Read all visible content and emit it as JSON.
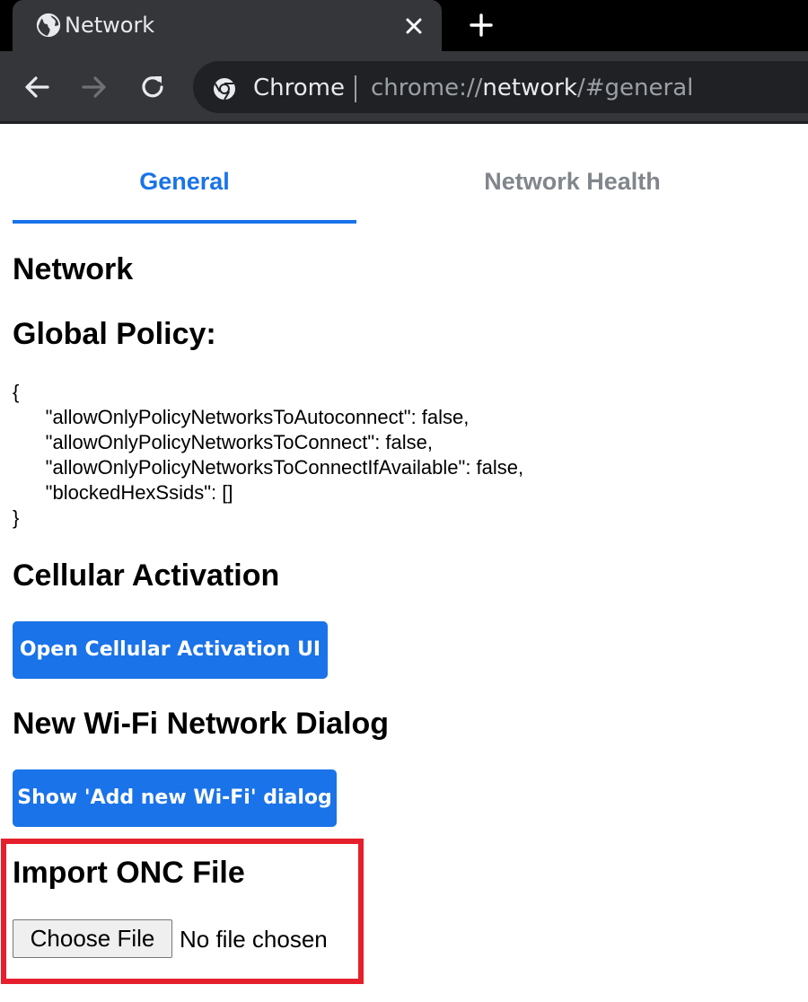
{
  "browser": {
    "tab_title": "Network",
    "omnibox_chip": "Chrome",
    "url_scheme": "chrome://",
    "url_host": "network",
    "url_path": "/#general"
  },
  "page_tabs": [
    {
      "label": "General",
      "selected": true
    },
    {
      "label": "Network Health",
      "selected": false
    }
  ],
  "sections": {
    "network_heading": "Network",
    "global_policy_heading": "Global Policy:",
    "global_policy_json": "{\n      \"allowOnlyPolicyNetworksToAutoconnect\": false,\n      \"allowOnlyPolicyNetworksToConnect\": false,\n      \"allowOnlyPolicyNetworksToConnectIfAvailable\": false,\n      \"blockedHexSsids\": []\n}",
    "cellular_heading": "Cellular Activation",
    "cellular_button": "Open Cellular Activation UI",
    "wifi_heading": "New Wi-Fi Network Dialog",
    "wifi_button": "Show 'Add new Wi-Fi' dialog",
    "onc_heading": "Import ONC File",
    "choose_file_button": "Choose File",
    "file_status": "No file chosen"
  },
  "colors": {
    "accent": "#1a73e8",
    "highlight_border": "#e5202c",
    "inactive_tab_text": "#80868b"
  },
  "icons": [
    "globe-icon",
    "close-icon",
    "plus-icon",
    "back-arrow-icon",
    "forward-arrow-icon",
    "reload-icon",
    "chrome-logo-icon"
  ]
}
